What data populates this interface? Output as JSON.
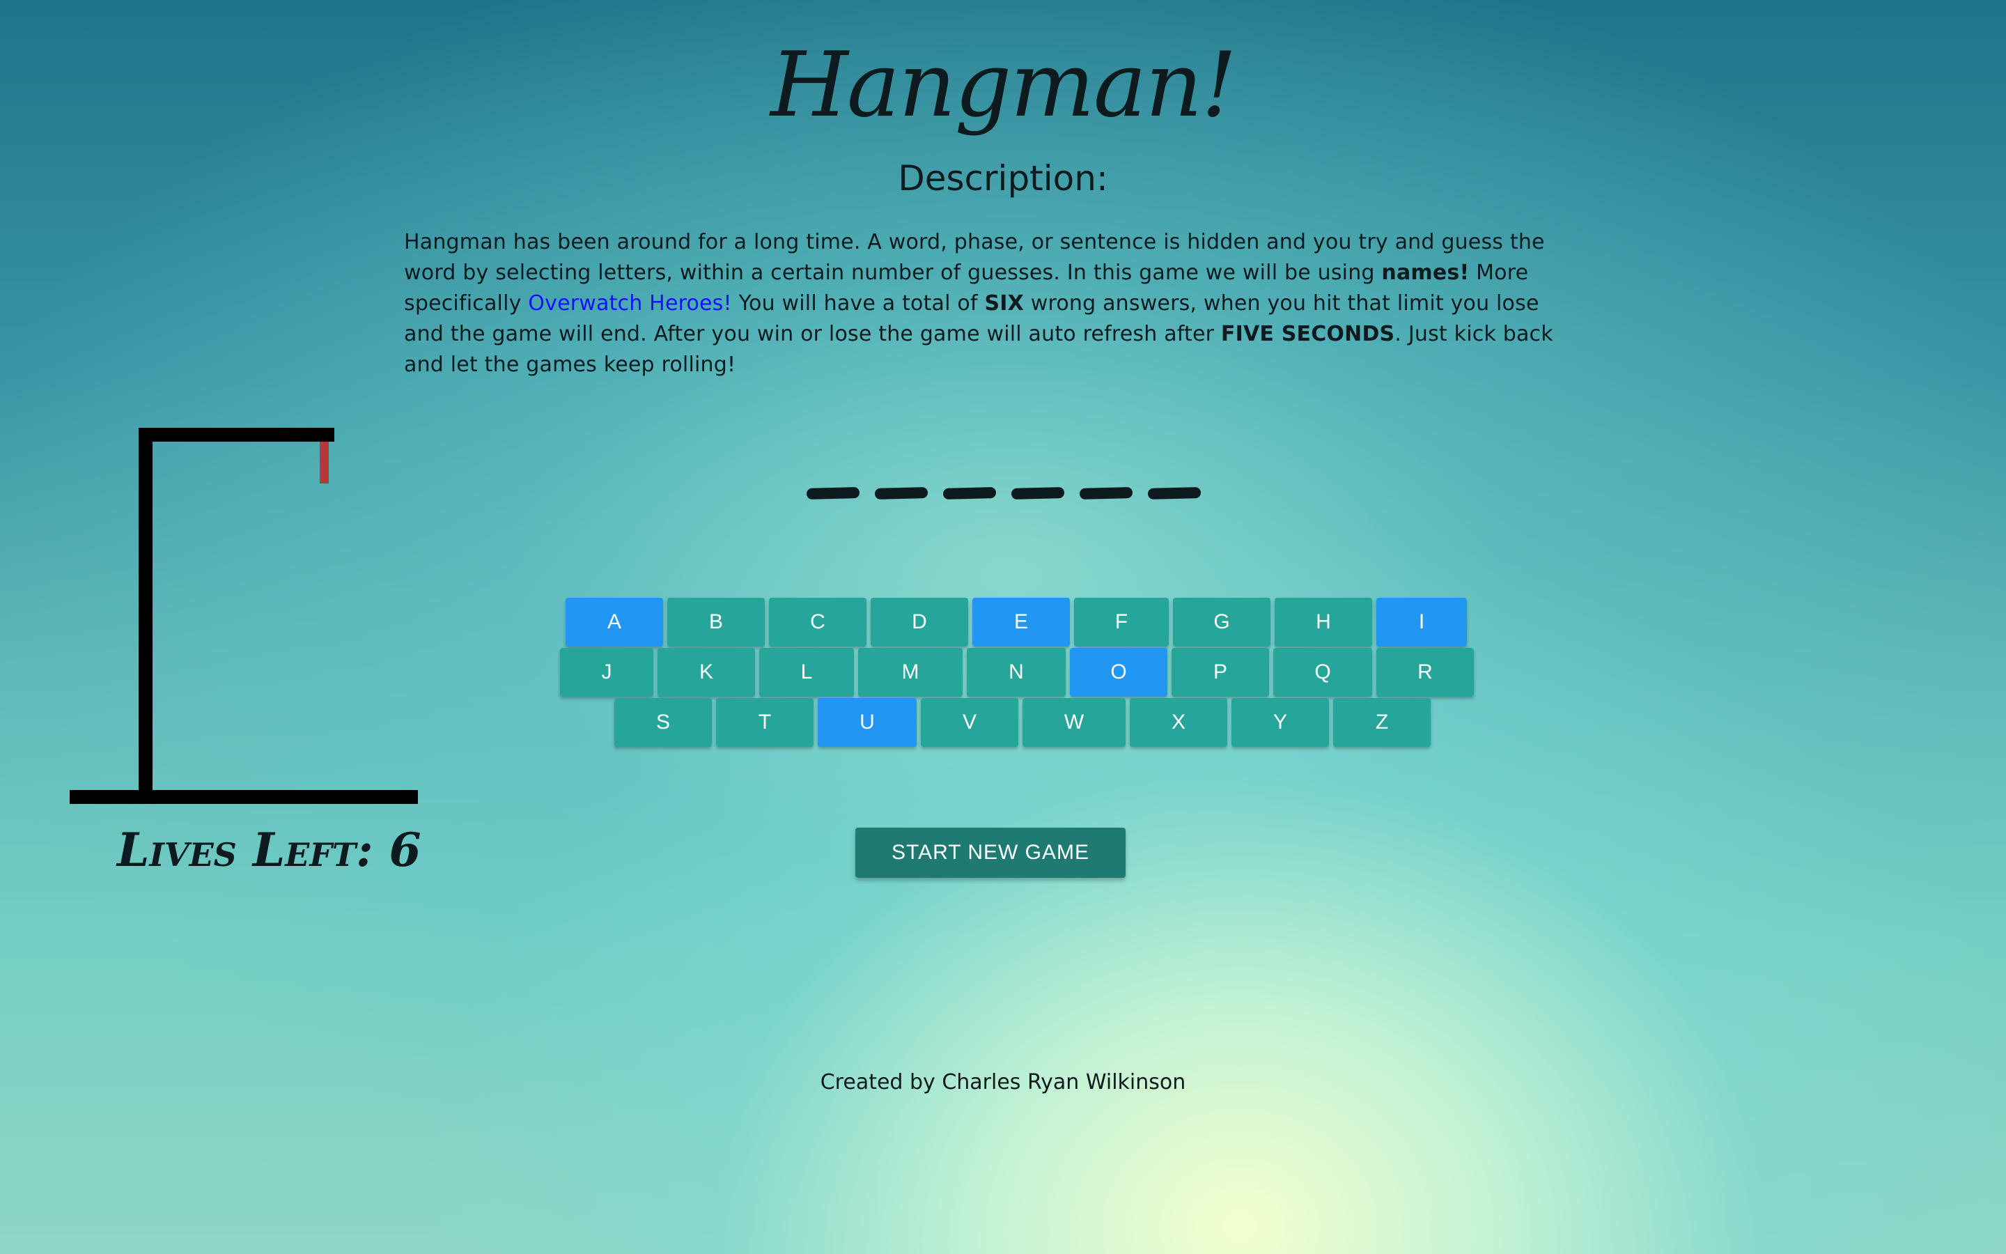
{
  "title": "Hangman!",
  "subtitle": "Description:",
  "description": {
    "part1": "Hangman has been around for a long time. A word, phase, or sentence is hidden and you try and guess the word by selecting letters, within a certain number of guesses. In this game we will be using ",
    "bold1": "names!",
    "part2": " More specifically ",
    "link": "Overwatch Heroes!",
    "part3": " You will have a total of ",
    "bold2": "SIX",
    "part4": " wrong answers, when you hit that limit you lose and the game will end. After you win or lose the game will auto refresh after ",
    "bold3": "FIVE SECONDS",
    "part5": ". Just kick back and let the games keep rolling!"
  },
  "lives_label": "Lives Left: 6",
  "word_blanks": 6,
  "keyboard": {
    "rows": [
      [
        "A",
        "B",
        "C",
        "D",
        "E",
        "F",
        "G",
        "H",
        "I"
      ],
      [
        "J",
        "K",
        "L",
        "M",
        "N",
        "O",
        "P",
        "Q",
        "R"
      ],
      [
        "S",
        "T",
        "U",
        "V",
        "W",
        "X",
        "Y",
        "Z"
      ]
    ],
    "used": [
      "A",
      "E",
      "I",
      "O",
      "U"
    ]
  },
  "start_button": "START NEW GAME",
  "footer": "Created by Charles Ryan Wilkinson",
  "colors": {
    "key": "#26a69a",
    "key_used": "#2196f3",
    "start_button": "#1f7a72",
    "rope": "#b33a3a",
    "link": "#1212ff"
  }
}
